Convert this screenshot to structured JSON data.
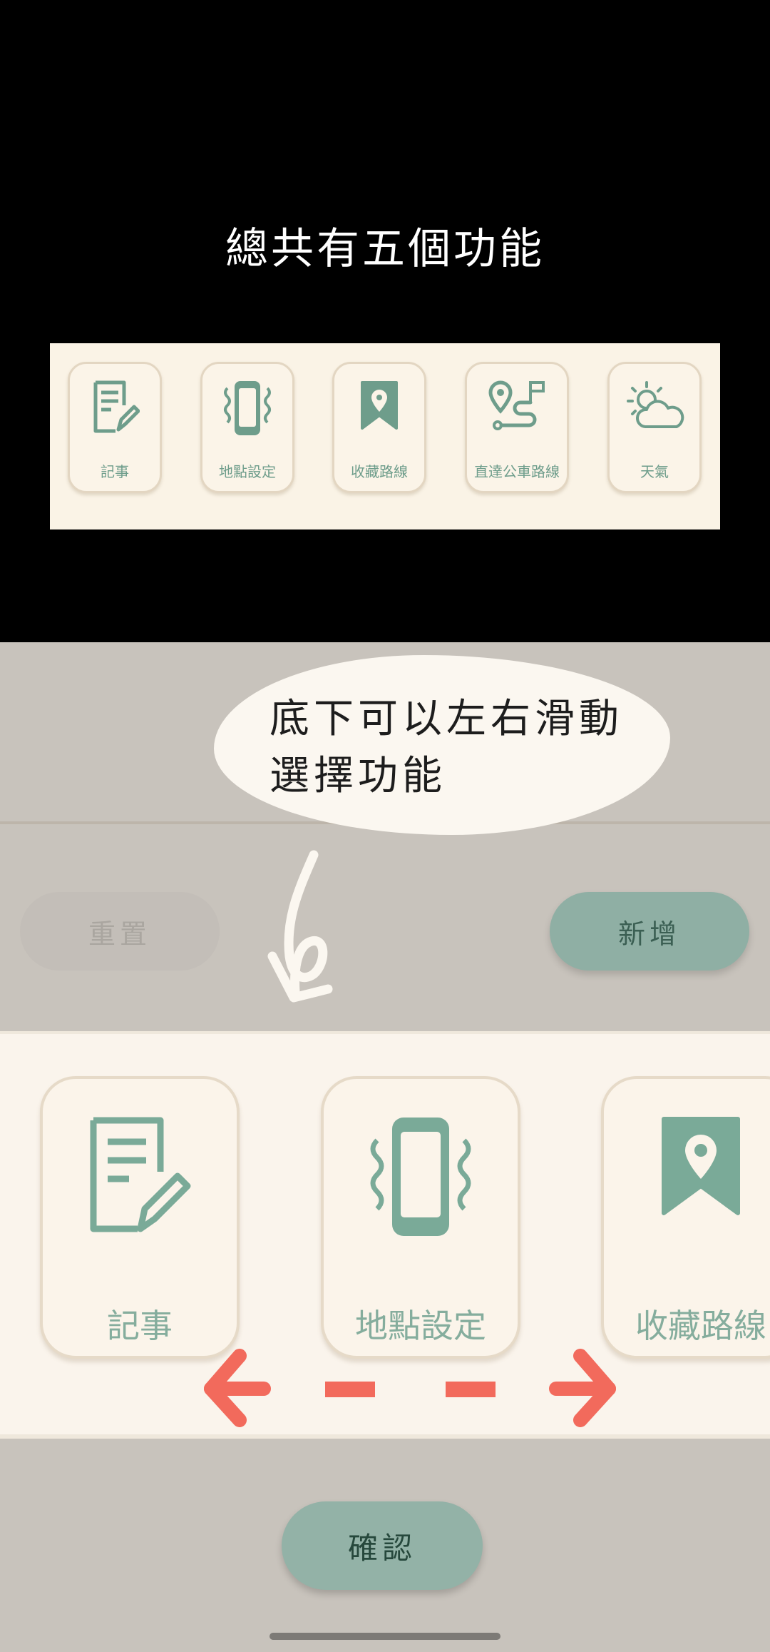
{
  "tutorial": {
    "title": "總共有五個功能",
    "preview_items": [
      {
        "label": "記事",
        "icon": "note-edit-icon"
      },
      {
        "label": "地點設定",
        "icon": "phone-vibrate-icon"
      },
      {
        "label": "收藏路線",
        "icon": "bookmark-location-icon"
      },
      {
        "label": "直達公車路線",
        "icon": "route-map-icon"
      },
      {
        "label": "天氣",
        "icon": "weather-cloud-sun-icon"
      }
    ]
  },
  "hint": {
    "line1": "底下可以左右滑動",
    "line2": "選擇功能"
  },
  "actions": {
    "reset_label": "重置",
    "add_label": "新增",
    "confirm_label": "確認"
  },
  "picker": {
    "items": [
      {
        "label": "記事",
        "icon": "note-edit-icon"
      },
      {
        "label": "地點設定",
        "icon": "phone-vibrate-icon"
      },
      {
        "label": "收藏路線",
        "icon": "bookmark-location-icon"
      }
    ]
  },
  "colors": {
    "accent": "#7aaa98",
    "arrow": "#f26a5c",
    "background": "#c8c3bc"
  }
}
